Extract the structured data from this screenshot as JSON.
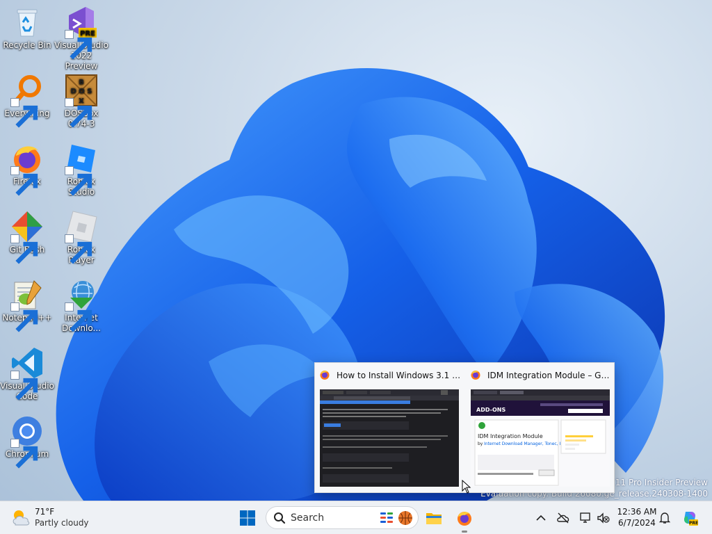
{
  "desktop": {
    "icons": [
      {
        "label": "Recycle Bin",
        "icon": "recycle-bin-icon",
        "shortcut": false
      },
      {
        "label": "Visual Studio 2022 Preview",
        "icon": "visual-studio-preview-icon",
        "shortcut": true,
        "badge": "PRE"
      },
      {
        "label": "Everything",
        "icon": "everything-search-icon",
        "shortcut": true
      },
      {
        "label": "DOSBox 0.74-3",
        "icon": "dosbox-icon",
        "shortcut": true,
        "badge": "BOX DOS"
      },
      {
        "label": "Firefox",
        "icon": "firefox-icon",
        "shortcut": true
      },
      {
        "label": "Roblox Studio",
        "icon": "roblox-studio-icon",
        "shortcut": true
      },
      {
        "label": "Git Bash",
        "icon": "git-bash-icon",
        "shortcut": true
      },
      {
        "label": "Roblox Player",
        "icon": "roblox-player-icon",
        "shortcut": true
      },
      {
        "label": "Notepad++",
        "icon": "notepad-plus-plus-icon",
        "shortcut": true
      },
      {
        "label": "Internet Downlo...",
        "icon": "internet-download-manager-icon",
        "shortcut": true
      },
      {
        "label": "Visual Studio Code",
        "icon": "vscode-icon",
        "shortcut": true
      },
      {
        "label": "Chromium",
        "icon": "chromium-icon",
        "shortcut": true
      }
    ]
  },
  "watermark": {
    "line1": "ws 11 Pro Insider Preview",
    "line2": "Evaluation copy. Build 26080.ge_release.240308-1400"
  },
  "preview": {
    "windows": [
      {
        "title": "How to Install Windows 3.1 in D...",
        "icon": "firefox-icon"
      },
      {
        "title": "IDM Integration Module – Get t...",
        "icon": "firefox-icon",
        "thumb": {
          "brand": "ADD-ONS",
          "heading": "IDM Integration Module",
          "by": "by",
          "author": "Internet Download Manager, Tonec, Inc."
        }
      }
    ]
  },
  "taskbar": {
    "weather": {
      "temp": "71°F",
      "condition": "Partly cloudy"
    },
    "search_placeholder": "Search",
    "clock": {
      "time": "12:36 AM",
      "date": "6/7/2024"
    },
    "colors": {
      "accent": "#0067c0",
      "taskbar_bg": "#eef1f5"
    }
  }
}
